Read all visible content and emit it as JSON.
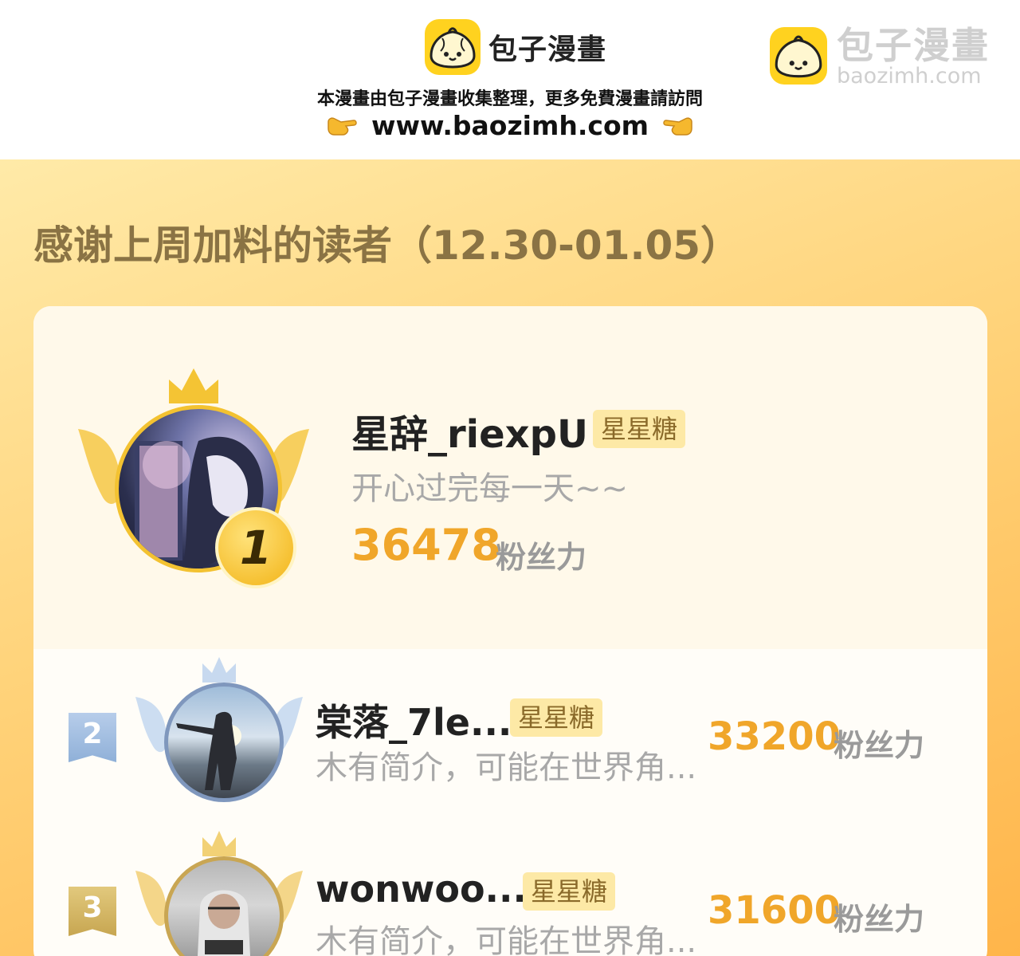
{
  "header": {
    "logo_text": "包子漫畫",
    "tagline": "本漫畫由包子漫畫收集整理，更多免費漫畫請訪問",
    "url": "www.baozimh.com",
    "watermark_title": "包子漫畫",
    "watermark_url": "baozimh.com"
  },
  "banner": {
    "title": "感谢上周加料的读者（12.30-01.05）"
  },
  "top_reader": {
    "rank": "1",
    "name": "星辞_riexpU",
    "badge": "星星糖",
    "bio": "开心过完每一天~~",
    "score": "36478",
    "unit": "粉丝力"
  },
  "readers": [
    {
      "rank": "2",
      "name": "棠落_7le...",
      "badge": "星星糖",
      "bio": "木有简介，可能在世界角...",
      "score": "33200",
      "unit": "粉丝力"
    },
    {
      "rank": "3",
      "name": "wonwoo...",
      "badge": "星星糖",
      "bio": "木有简介，可能在世界角...",
      "score": "31600",
      "unit": "粉丝力"
    }
  ],
  "colors": {
    "accent": "#f0a62a",
    "gold": "#f7c531",
    "silver": "#9ab6d8",
    "bronze": "#d8b869",
    "badge_bg": "#fde9a6"
  }
}
